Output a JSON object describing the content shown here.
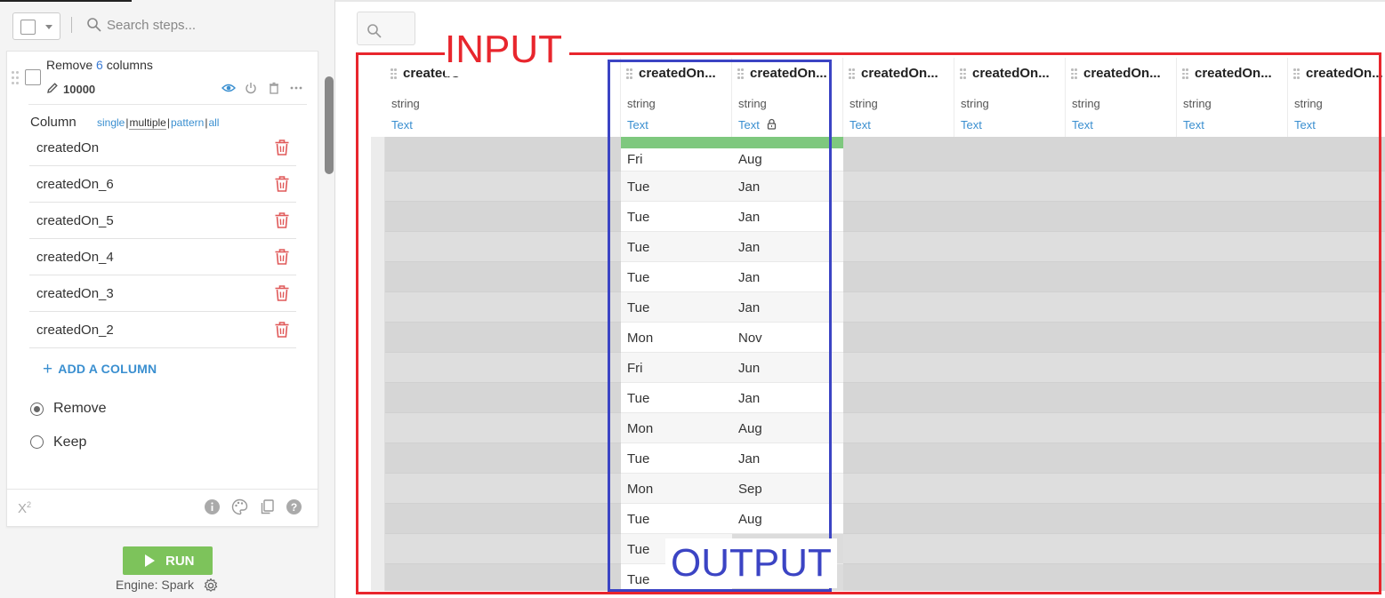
{
  "left_panel": {
    "search_placeholder": "Search steps...",
    "step": {
      "title_prefix": "Remove",
      "title_count": "6",
      "title_suffix": "columns",
      "step_id": "10000",
      "column_label": "Column",
      "modes": [
        "single",
        "multiple",
        "pattern",
        "all"
      ],
      "active_mode": "multiple",
      "columns": [
        "createdOn",
        "createdOn_6",
        "createdOn_5",
        "createdOn_4",
        "createdOn_3",
        "createdOn_2"
      ],
      "add_column_label": "ADD A COLUMN",
      "options": [
        "Remove",
        "Keep"
      ],
      "selected_option": "Remove"
    },
    "run_label": "RUN",
    "engine_label": "Engine: Spark"
  },
  "grid": {
    "columns": [
      {
        "name": "createdO",
        "type": "string",
        "format": "Text",
        "locked": false,
        "highlight": "gray"
      },
      {
        "name": "createdOn...",
        "type": "string",
        "format": "Text",
        "locked": false,
        "highlight": "output"
      },
      {
        "name": "createdOn...",
        "type": "string",
        "format": "Text",
        "locked": true,
        "highlight": "output"
      },
      {
        "name": "createdOn...",
        "type": "string",
        "format": "Text",
        "locked": false,
        "highlight": "gray"
      },
      {
        "name": "createdOn...",
        "type": "string",
        "format": "Text",
        "locked": false,
        "highlight": "gray"
      },
      {
        "name": "createdOn...",
        "type": "string",
        "format": "Text",
        "locked": false,
        "highlight": "gray"
      },
      {
        "name": "createdOn...",
        "type": "string",
        "format": "Text",
        "locked": false,
        "highlight": "gray"
      },
      {
        "name": "createdOn...",
        "type": "string",
        "format": "Text",
        "locked": false,
        "highlight": "gray"
      }
    ],
    "day_values": [
      "Fri",
      "Tue",
      "Tue",
      "Tue",
      "Tue",
      "Tue",
      "Mon",
      "Fri",
      "Tue",
      "Mon",
      "Tue",
      "Mon",
      "Tue",
      "Tue",
      "Tue"
    ],
    "month_values": [
      "Aug",
      "Jan",
      "Jan",
      "Jan",
      "Jan",
      "Jan",
      "Nov",
      "Jun",
      "Jan",
      "Aug",
      "Jan",
      "Sep",
      "Aug",
      "",
      ""
    ]
  },
  "annotations": {
    "input_label": "INPUT",
    "output_label": "OUTPUT"
  },
  "colors": {
    "accent": "#3a8fd0",
    "run_green": "#7dc35b",
    "input_red": "#e8262d",
    "output_blue": "#3b44c4",
    "trash_red": "#e05a5a"
  }
}
